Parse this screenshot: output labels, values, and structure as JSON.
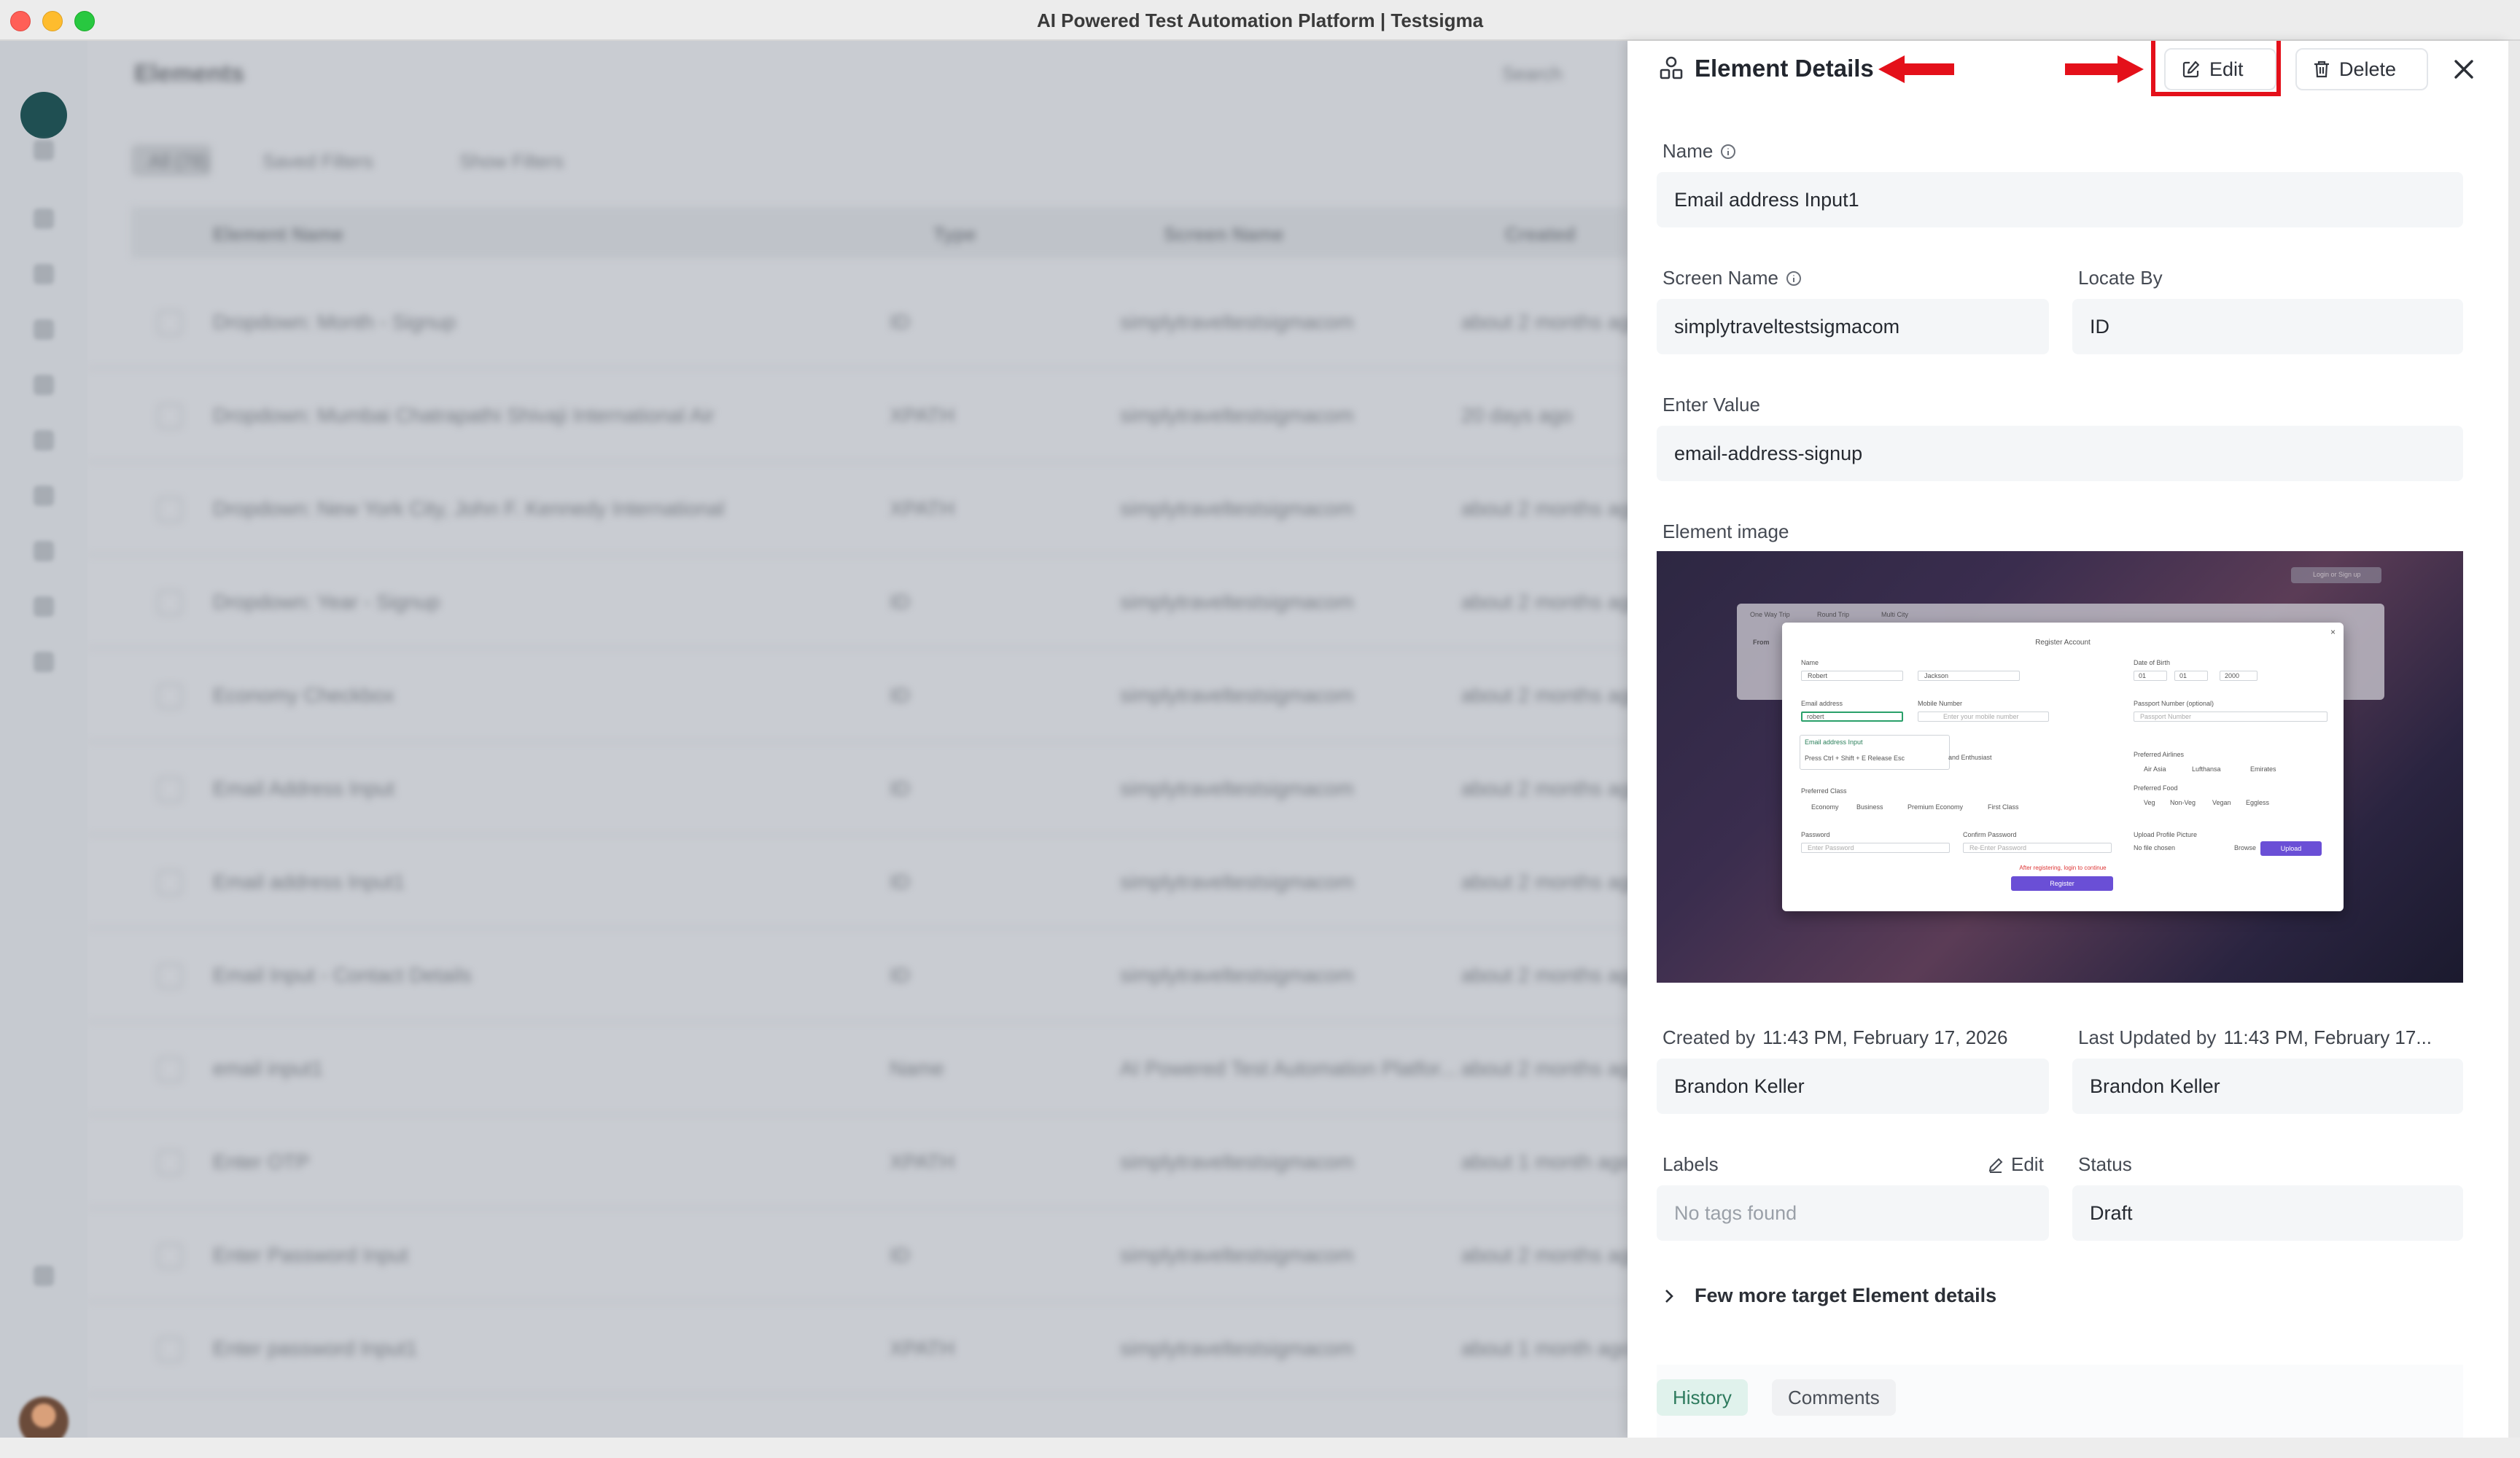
{
  "window": {
    "title": "AI Powered Test Automation Platform | Testsigma"
  },
  "background": {
    "page_title": "Elements",
    "search_label": "Search",
    "filters": {
      "all": "All (78)",
      "saved": "Saved Filters",
      "show": "Show Filters"
    },
    "columns": [
      "Element Name",
      "Type",
      "Screen Name",
      "Created"
    ],
    "rows": [
      [
        "Dropdown: Month - Signup",
        "ID",
        "simplytraveltestsigmacom",
        "about 2 months ago"
      ],
      [
        "Dropdown: Mumbai Chatrapathi Shivaji International Air",
        "XPATH",
        "simplytraveltestsigmacom",
        "20 days ago"
      ],
      [
        "Dropdown: New York City, John F. Kennedy International",
        "XPATH",
        "simplytraveltestsigmacom",
        "about 2 months ago"
      ],
      [
        "Dropdown: Year - Signup",
        "ID",
        "simplytraveltestsigmacom",
        "about 2 months ago"
      ],
      [
        "Economy Checkbox",
        "ID",
        "simplytraveltestsigmacom",
        "about 2 months ago"
      ],
      [
        "Email Address Input",
        "ID",
        "simplytraveltestsigmacom",
        "about 2 months ago"
      ],
      [
        "Email address Input1",
        "ID",
        "simplytraveltestsigmacom",
        "about 2 months ago"
      ],
      [
        "Email Input - Contact Details",
        "ID",
        "simplytraveltestsigmacom",
        "about 2 months ago"
      ],
      [
        "email input1",
        "Name",
        "AI Powered Test Automation Platfor...",
        "about 2 months ago"
      ],
      [
        "Enter OTP",
        "XPATH",
        "simplytraveltestsigmacom",
        "about 1 month ago"
      ],
      [
        "Enter Password Input",
        "ID",
        "simplytraveltestsigmacom",
        "about 2 months ago"
      ],
      [
        "Enter password Input1",
        "XPATH",
        "simplytraveltestsigmacom",
        "about 1 month ago"
      ]
    ]
  },
  "panel": {
    "title": "Element Details",
    "edit_label": "Edit",
    "delete_label": "Delete",
    "fields": {
      "name_label": "Name",
      "name_value": "Email address Input1",
      "screen_label": "Screen Name",
      "screen_value": "simplytraveltestsigmacom",
      "locate_label": "Locate By",
      "locate_value": "ID",
      "value_label": "Enter Value",
      "value_value": "email-address-signup",
      "image_label": "Element image",
      "created_label": "Created by",
      "created_time": "11:43 PM, February 17, 2026",
      "created_user": "Brandon Keller",
      "updated_label": "Last Updated by",
      "updated_time": "11:43 PM, February 17...",
      "updated_user": "Brandon Keller",
      "labels_label": "Labels",
      "labels_edit": "Edit",
      "labels_value": "No tags found",
      "status_label": "Status",
      "status_value": "Draft"
    },
    "more_details": "Few more target Element details",
    "tabs": [
      "History",
      "Comments"
    ]
  },
  "preview": {
    "trip_options": [
      "One Way Trip",
      "Round Trip",
      "Multi City"
    ],
    "from_label": "From",
    "login_btn": "Login or Sign up",
    "modal_title": "Register Account",
    "name_label": "Name",
    "first_name": "Robert",
    "last_name": "Jackson",
    "dob_label": "Date of Birth",
    "dob": [
      "01",
      "01",
      "2000"
    ],
    "email_label": "Email address",
    "email_value": "robert",
    "mobile_label": "Mobile Number",
    "mobile_placeholder": "Enter your mobile number",
    "passport_label": "Passport Number (optional)",
    "passport_placeholder": "Passport Number",
    "tooltip_title": "Email address Input",
    "tooltip_text": "Press Ctrl + Shift + E Release Esc",
    "tooltip_tail": "and Enthusiast",
    "airline_label": "Preferred Airlines",
    "airlines": [
      "Air Asia",
      "Lufthansa",
      "Emirates"
    ],
    "food_label": "Preferred Food",
    "foods": [
      "Veg",
      "Non-Veg",
      "Vegan",
      "Eggless"
    ],
    "class_label": "Preferred Class",
    "classes": [
      "Economy",
      "Business",
      "Premium Economy",
      "First Class"
    ],
    "upload_label": "Upload Profile Picture",
    "no_file": "No file chosen",
    "browse": "Browse",
    "upload_btn": "Upload",
    "password_label": "Password",
    "password_placeholder": "Enter Password",
    "confirm_label": "Confirm Password",
    "confirm_placeholder": "Re-Enter Password",
    "notice": "After registering, login to continue",
    "register_btn": "Register"
  }
}
